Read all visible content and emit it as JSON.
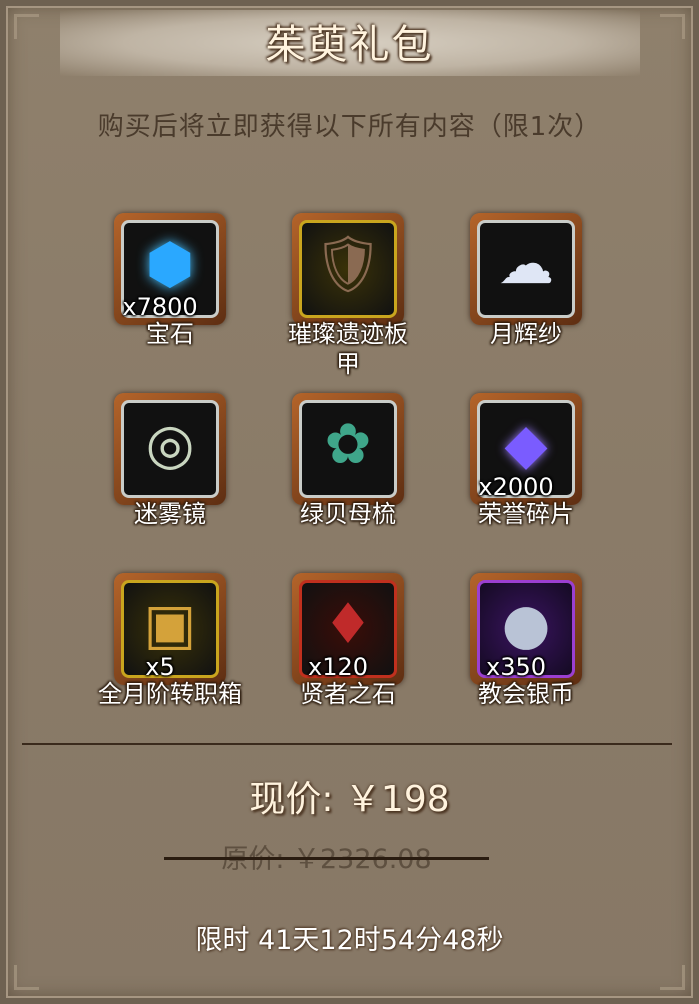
{
  "header": {
    "title": "茱萸礼包",
    "subtitle": "购买后将立即获得以下所有内容（限1次）"
  },
  "items": [
    {
      "name": "宝石",
      "qty": "x7800",
      "icon": "gem-icon",
      "frame": "gray",
      "color": "#2aa8ff"
    },
    {
      "name": "璀璨遗迹板甲",
      "qty": "",
      "icon": "armor-icon",
      "frame": "gold",
      "color": "#8a6a52"
    },
    {
      "name": "月辉纱",
      "qty": "",
      "icon": "silk-icon",
      "frame": "gray",
      "color": "#dfe6f5"
    },
    {
      "name": "迷雾镜",
      "qty": "",
      "icon": "mirror-icon",
      "frame": "gray",
      "color": "#c9d6c0"
    },
    {
      "name": "绿贝母梳",
      "qty": "",
      "icon": "comb-icon",
      "frame": "gray",
      "color": "#3fa68a"
    },
    {
      "name": "荣誉碎片",
      "qty": "x2000",
      "icon": "crystal-icon",
      "frame": "gray",
      "color": "#7a5cff"
    },
    {
      "name": "全月阶转职箱",
      "qty": "x5",
      "icon": "chest-icon",
      "frame": "gold",
      "color": "#d4a23a"
    },
    {
      "name": "贤者之石",
      "qty": "x120",
      "icon": "sage-stone-icon",
      "frame": "red",
      "color": "#c02a2a"
    },
    {
      "name": "教会银币",
      "qty": "x350",
      "icon": "silver-coin-icon",
      "frame": "purple",
      "color": "#b9c3d6"
    }
  ],
  "price": {
    "current": "现价: ￥198",
    "original": "原价: ￥2326.08"
  },
  "timer": "限时 41天12时54分48秒"
}
